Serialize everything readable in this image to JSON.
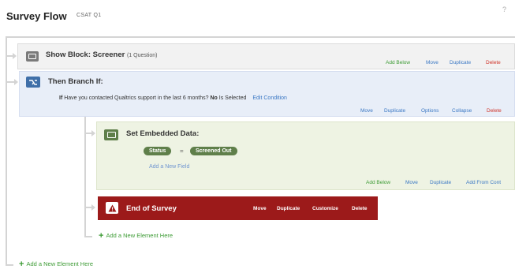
{
  "header": {
    "title": "Survey Flow",
    "subtitle": "CSAT Q1",
    "corner": "?"
  },
  "show_block": {
    "label": "Show Block: Screener",
    "question_count": "(1 Question)",
    "actions": {
      "add_below": "Add Below",
      "move": "Move",
      "duplicate": "Duplicate",
      "delete": "Delete"
    }
  },
  "branch": {
    "label": "Then Branch If:",
    "condition": {
      "if": "If",
      "question": "Have you contacted Qualtrics support in the last 6 months?",
      "answer": "No",
      "is": "Is",
      "state": "Selected",
      "edit": "Edit Condition"
    },
    "actions": {
      "move": "Move",
      "duplicate": "Duplicate",
      "options": "Options",
      "collapse": "Collapse",
      "delete": "Delete"
    }
  },
  "embedded": {
    "label": "Set Embedded Data:",
    "field_name": "Status",
    "equals": "=",
    "field_value": "Screened Out",
    "add_field": "Add a New Field",
    "actions": {
      "add_below": "Add Below",
      "move": "Move",
      "duplicate": "Duplicate",
      "add_from_contact": "Add From Cont"
    }
  },
  "end_survey": {
    "label": "End of Survey",
    "actions": {
      "move": "Move",
      "duplicate": "Duplicate",
      "customize": "Customize",
      "delete": "Delete"
    }
  },
  "add_inner": "Add a New Element Here",
  "add_outer": "Add a New Element Here",
  "colors": {
    "accent_green": "#3d9b35",
    "link_blue": "#3b78c4",
    "delete_red": "#d0352b",
    "end_survey_bg": "#9c1a1a",
    "branch_icon": "#3f6fa8",
    "pill_green": "#5f7f4a"
  }
}
